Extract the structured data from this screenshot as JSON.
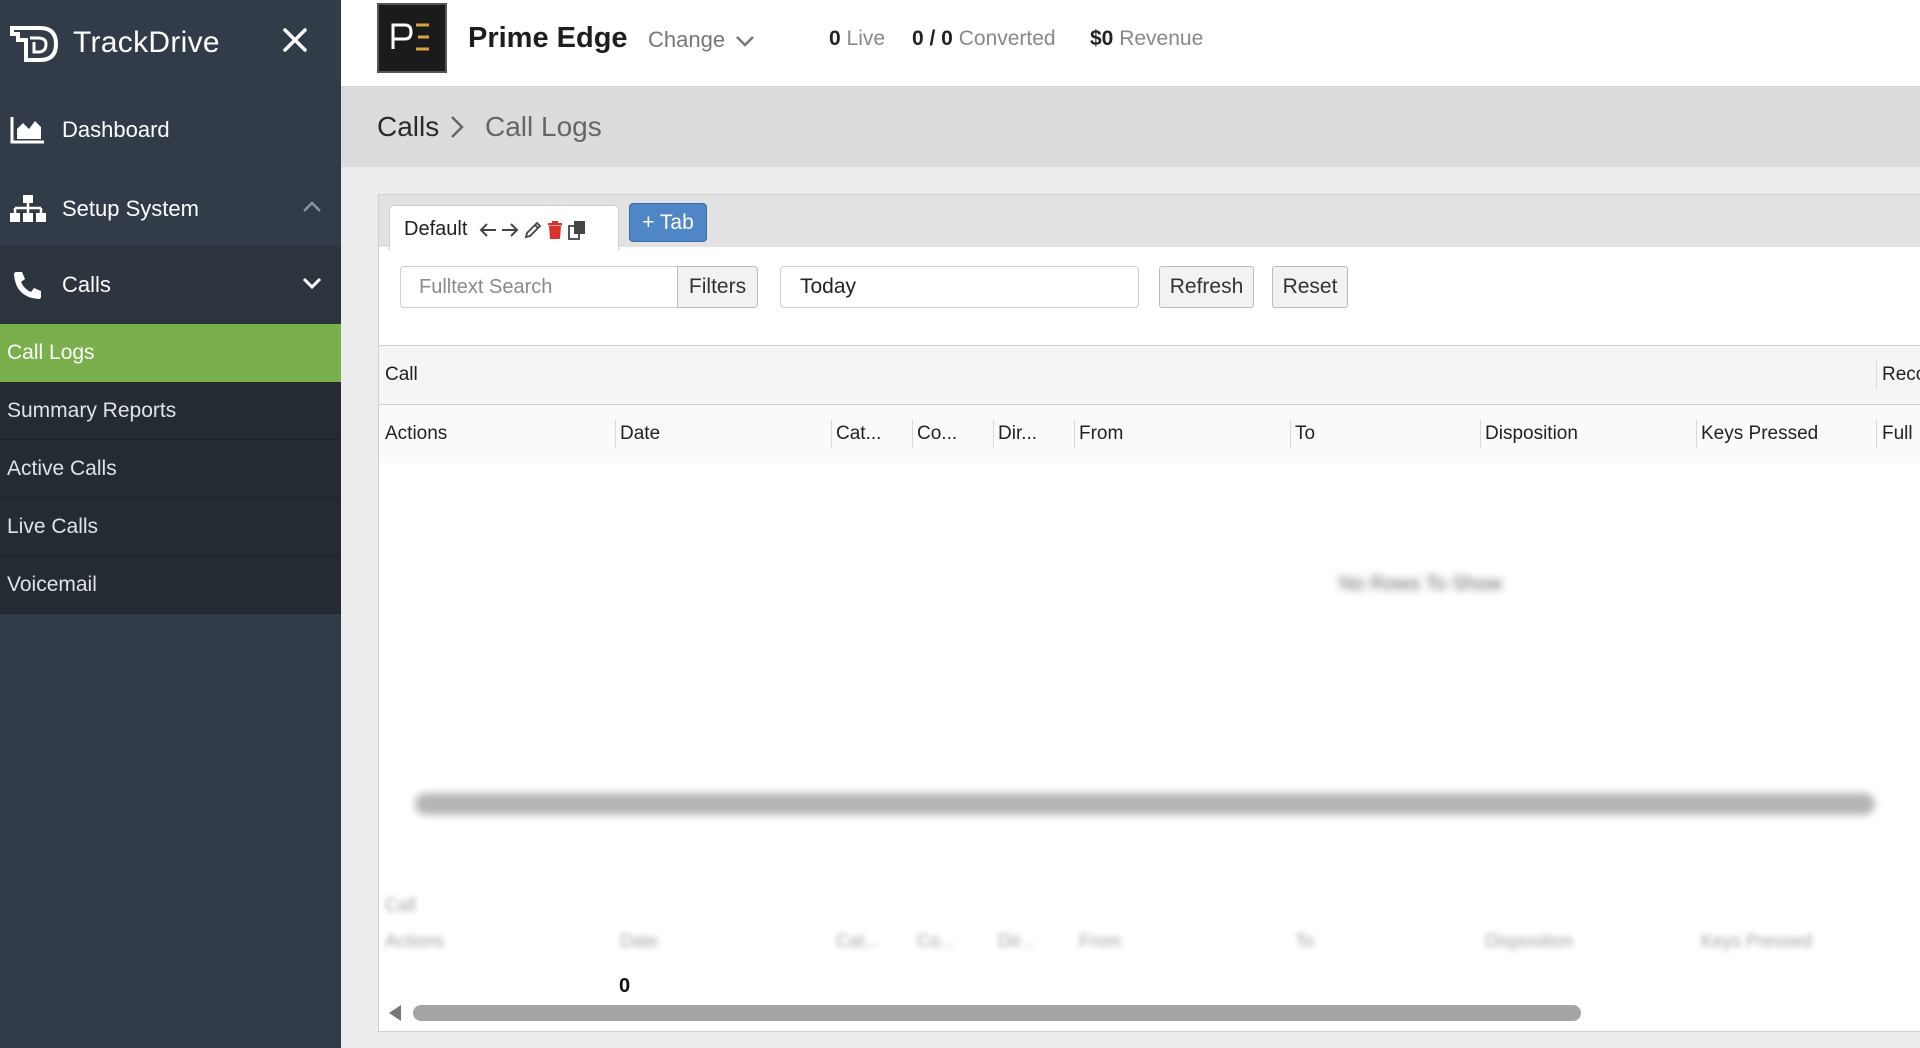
{
  "sidebar": {
    "brand": "TrackDrive",
    "nav": {
      "dashboard": "Dashboard",
      "setup": "Setup System",
      "calls": "Calls"
    },
    "sub_items": [
      "Call Logs",
      "Summary Reports",
      "Active Calls",
      "Live Calls",
      "Voicemail"
    ]
  },
  "topbar": {
    "company": "Prime Edge",
    "change_label": "Change",
    "live_count": "0",
    "live_label": "Live",
    "converted_count": "0 / 0",
    "converted_label": "Converted",
    "revenue_value": "$0",
    "revenue_label": "Revenue"
  },
  "breadcrumb": {
    "parent": "Calls",
    "current": "Call Logs"
  },
  "tabs": {
    "active_tab": "Default",
    "add_tab_label": "+ Tab"
  },
  "filters": {
    "search_placeholder": "Fulltext Search",
    "filters_label": "Filters",
    "date_range": "Today",
    "refresh_label": "Refresh",
    "reset_label": "Reset"
  },
  "grid": {
    "group_headers": [
      "Call",
      "Reco"
    ],
    "columns": [
      "Actions",
      "Date",
      "Cat...",
      "Co...",
      "Dir...",
      "From",
      "To",
      "Disposition",
      "Keys Pressed",
      "Full"
    ],
    "empty_message": "No Rows To Show",
    "row_count": "0"
  },
  "colors": {
    "sidebar_bg": "#323b48",
    "active_item": "#7ab04c",
    "add_tab_button": "#4f86c6",
    "delete_icon": "#d9342b"
  }
}
